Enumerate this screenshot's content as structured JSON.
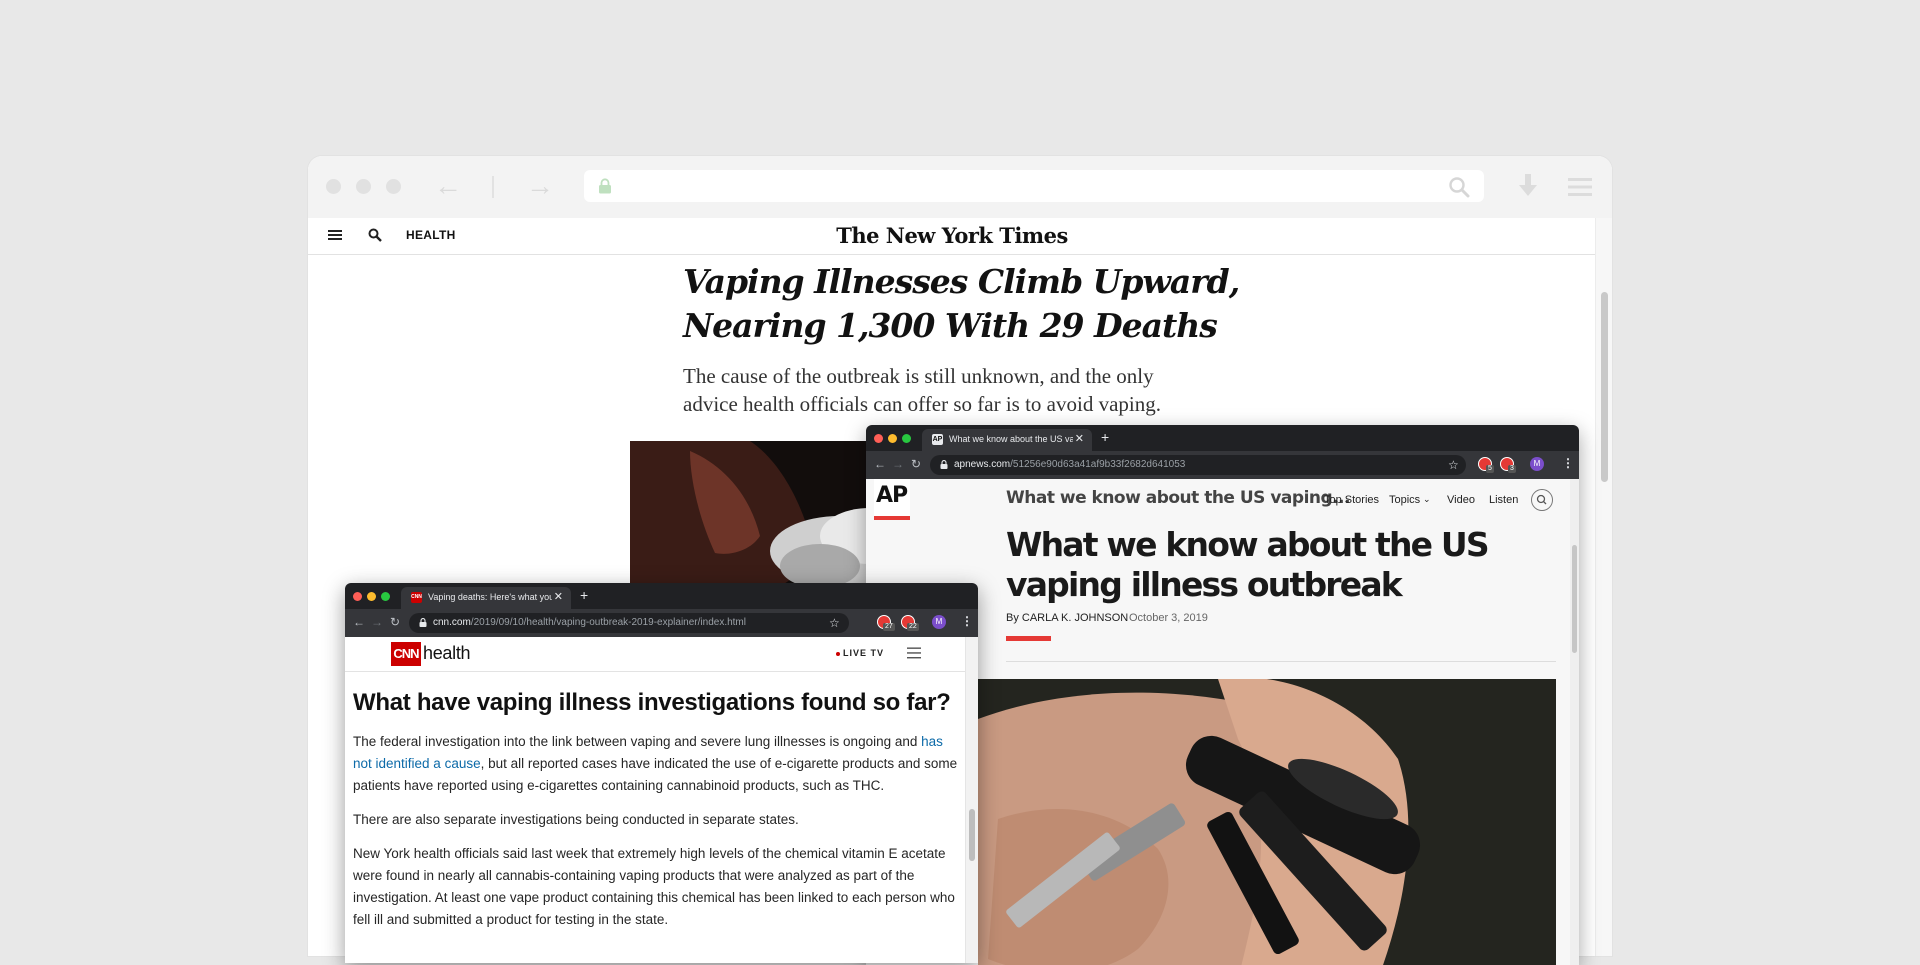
{
  "nyt": {
    "section": "HEALTH",
    "logo": "The New York Times",
    "headline": "Vaping Illnesses Climb Upward, Nearing 1,300 With 29 Deaths",
    "summary": "The cause of the outbreak is still unknown, and the only advice health officials can offer so far is to avoid vaping."
  },
  "ap": {
    "tab_title": "What we know about the US vaping illness outbreak",
    "url_domain": "apnews.com",
    "url_path": "/51256e90d63a41af9b33f2682d641053",
    "ext_badges": [
      "5",
      "3"
    ],
    "profile_initial": "M",
    "logo": "AP",
    "header_title": "What we know about the US vaping...",
    "nav": [
      "Top Stories",
      "Topics",
      "Video",
      "Listen"
    ],
    "headline": "What we know about the US vaping illness outbreak",
    "byline": "By CARLA K. JOHNSON",
    "date": "October 3, 2019"
  },
  "cnn": {
    "tab_title": "Vaping deaths: Here's what you need to know",
    "url_domain": "cnn.com",
    "url_path": "/2019/09/10/health/vaping-outbreak-2019-explainer/index.html",
    "ext_badges": [
      "27",
      "22"
    ],
    "profile_initial": "M",
    "logo": "CNN",
    "section": "health",
    "live_tv": "LIVE TV",
    "heading": "What have vaping illness investigations found so far?",
    "p1_before": "The federal investigation into the link between vaping and severe lung illnesses is ongoing and ",
    "p1_link": "has not identified a cause",
    "p1_after": ", but all reported cases have indicated the use of e-cigarette products and some patients have reported using e-cigarettes containing cannabinoid products, such as THC.",
    "p2": "There are also separate investigations being conducted in separate states.",
    "p3": "New York health officials said last week that extremely high levels of the chemical vitamin E acetate were found in nearly all cannabis-containing vaping products that were analyzed as part of the investigation. At least one vape product containing this chemical has been linked to each person who fell ill and submitted a product for testing in the state."
  },
  "colors": {
    "ap_red": "#e53935",
    "cnn_red": "#cc0000",
    "cnn_link": "#0c6aa8",
    "chrome_dark": "#202124"
  }
}
